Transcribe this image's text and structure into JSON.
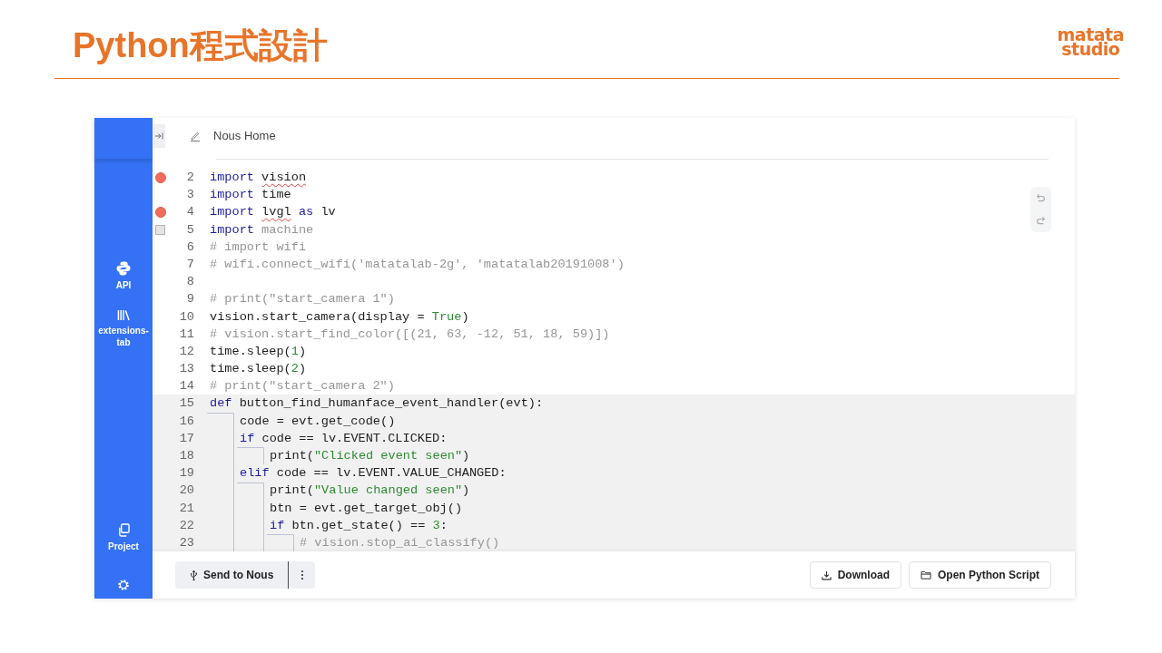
{
  "slide": {
    "title": "Python程式設計",
    "logo": [
      "matata",
      "studio"
    ]
  },
  "sidebar": {
    "top_items": [
      {
        "label": "API"
      },
      {
        "label": "extensions-tab"
      }
    ],
    "bottom_items": [
      {
        "label": "Project"
      }
    ]
  },
  "editor": {
    "file_title": "Nous Home",
    "lines": [
      {
        "number": "2",
        "kind": "error",
        "tokens": [
          {
            "kind": "keyword",
            "text": "import "
          },
          {
            "kind": "unresolved",
            "text": "vision"
          }
        ]
      },
      {
        "number": "3",
        "kind": "plain",
        "tokens": [
          {
            "kind": "keyword",
            "text": "import"
          },
          {
            "kind": "plain",
            "text": " time"
          }
        ]
      },
      {
        "number": "4",
        "kind": "error",
        "tokens": [
          {
            "kind": "keyword",
            "text": "import "
          },
          {
            "kind": "unresolved",
            "text": "lvgl"
          },
          {
            "kind": "keyword",
            "text": " as"
          },
          {
            "kind": "plain",
            "text": " lv"
          }
        ]
      },
      {
        "number": "5",
        "kind": "unused",
        "tokens": [
          {
            "kind": "keyword",
            "text": "import "
          },
          {
            "kind": "unused",
            "text": "machine"
          }
        ]
      },
      {
        "number": "6",
        "kind": "plain",
        "tokens": [
          {
            "kind": "comment",
            "text": "# import wifi"
          }
        ]
      },
      {
        "number": "7",
        "kind": "plain",
        "tokens": [
          {
            "kind": "comment",
            "text": "# wifi.connect_wifi('matatalab-2g', 'matatalab20191008')"
          }
        ]
      },
      {
        "number": "8",
        "kind": "plain"
      },
      {
        "number": "9",
        "kind": "plain",
        "tokens": [
          {
            "kind": "comment",
            "text": "# print(\"start_camera 1\")"
          }
        ]
      },
      {
        "number": "10",
        "kind": "plain",
        "tokens": [
          {
            "kind": "plain",
            "text": "vision.start_camera(display = "
          },
          {
            "kind": "literal",
            "text": "True"
          },
          {
            "kind": "plain",
            "text": ")"
          }
        ]
      },
      {
        "number": "11",
        "kind": "plain",
        "tokens": [
          {
            "kind": "comment",
            "text": "# vision.start_find_color([(21, 63, -12, 51, 18, 59)])"
          }
        ]
      },
      {
        "number": "12",
        "kind": "plain",
        "tokens": [
          {
            "kind": "plain",
            "text": "time.sleep("
          },
          {
            "kind": "literal",
            "text": "1"
          },
          {
            "kind": "plain",
            "text": ")"
          }
        ]
      },
      {
        "number": "13",
        "kind": "plain",
        "tokens": [
          {
            "kind": "plain",
            "text": "time.sleep("
          },
          {
            "kind": "literal",
            "text": "2"
          },
          {
            "kind": "plain",
            "text": ")"
          }
        ]
      },
      {
        "number": "14",
        "kind": "plain",
        "tokens": [
          {
            "kind": "comment",
            "text": "# print(\"start_camera 2\")"
          }
        ]
      },
      {
        "number": "15",
        "kind": "plain",
        "tokens": [
          {
            "kind": "keyword",
            "text": "def"
          },
          {
            "kind": "plain",
            "text": " button_find_humanface_event_handler(evt):"
          }
        ],
        "children": [
          {
            "number": "16",
            "tokens": [
              {
                "kind": "plain",
                "text": "code = evt.get_code()"
              }
            ]
          },
          {
            "number": "17",
            "tokens": [
              {
                "kind": "keyword",
                "text": "if"
              },
              {
                "kind": "plain",
                "text": " code == lv.EVENT.CLICKED:"
              }
            ],
            "children": [
              {
                "number": "18",
                "tokens": [
                  {
                    "kind": "plain",
                    "text": "print("
                  },
                  {
                    "kind": "literal",
                    "text": "\"Clicked event seen\""
                  },
                  {
                    "kind": "plain",
                    "text": ")"
                  }
                ]
              }
            ]
          },
          {
            "number": "19",
            "tokens": [
              {
                "kind": "keyword",
                "text": "elif"
              },
              {
                "kind": "plain",
                "text": " code == lv.EVENT.VALUE_CHANGED:"
              }
            ],
            "children": [
              {
                "number": "20",
                "tokens": [
                  {
                    "kind": "plain",
                    "text": "print("
                  },
                  {
                    "kind": "literal",
                    "text": "\"Value changed seen\""
                  },
                  {
                    "kind": "plain",
                    "text": ")"
                  }
                ]
              },
              {
                "number": "21",
                "tokens": [
                  {
                    "kind": "plain",
                    "text": "btn = evt.get_target_obj()"
                  }
                ]
              },
              {
                "number": "22",
                "tokens": [
                  {
                    "kind": "keyword",
                    "text": "if"
                  },
                  {
                    "kind": "plain",
                    "text": " btn.get_state() == "
                  },
                  {
                    "kind": "literal",
                    "text": "3"
                  },
                  {
                    "kind": "plain",
                    "text": ":"
                  }
                ],
                "children": [
                  {
                    "number": "23",
                    "tokens": [
                      {
                        "kind": "comment",
                        "text": "# vision.stop_ai_classify()"
                      }
                    ]
                  }
                ]
              }
            ]
          }
        ]
      }
    ]
  },
  "toolbar": {
    "left_buttons": [
      {
        "label": "Send to Nous"
      }
    ],
    "right_buttons": [
      {
        "label": "Download"
      },
      {
        "label": "Open Python Script"
      }
    ]
  }
}
